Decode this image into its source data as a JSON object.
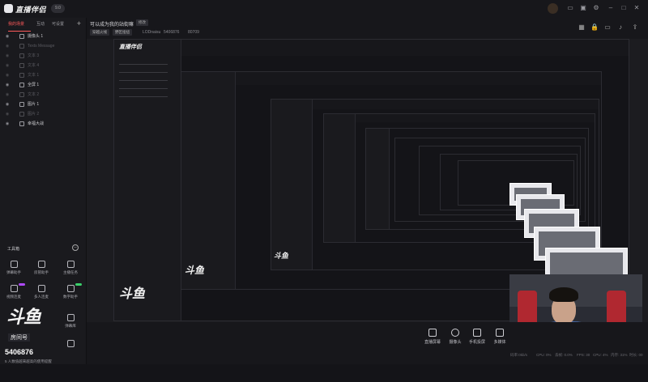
{
  "app": {
    "name": "直播伴侣",
    "version": "9.0"
  },
  "sidebar": {
    "tabs": [
      {
        "label": "我的场景",
        "active": true
      },
      {
        "label": "互动",
        "active": false
      },
      {
        "label": "可设置",
        "active": false
      }
    ],
    "sources": [
      {
        "label": "摄像头 1",
        "icon": "camera-icon",
        "enabled": true
      },
      {
        "label": "Texts Message",
        "icon": "text-icon",
        "enabled": false
      },
      {
        "label": "文本 3",
        "icon": "text-icon",
        "enabled": false
      },
      {
        "label": "文本 4",
        "icon": "text-icon",
        "enabled": false
      },
      {
        "label": "文本 1",
        "icon": "text-icon",
        "enabled": false
      },
      {
        "label": "全屏 1",
        "icon": "fullscreen-icon",
        "enabled": true
      },
      {
        "label": "文本 2",
        "icon": "text-icon",
        "enabled": false
      },
      {
        "label": "图片 1",
        "icon": "image-icon",
        "enabled": true
      },
      {
        "label": "图片 2",
        "icon": "image-icon",
        "enabled": false
      },
      {
        "label": "幸福大战",
        "icon": "game-icon",
        "enabled": true
      }
    ],
    "tools_title": "工具箱",
    "tools": [
      {
        "label": "弹幕助手",
        "icon": "danmaku-icon"
      },
      {
        "label": "房管助手",
        "icon": "admin-icon"
      },
      {
        "label": "主播任务",
        "icon": "task-icon"
      },
      {
        "label": "视频连麦",
        "icon": "video-link-icon"
      },
      {
        "label": "多人连麦",
        "icon": "multi-link-icon"
      },
      {
        "label": "数字助手",
        "icon": "digital-icon"
      },
      {
        "label": "",
        "icon": "record-icon"
      },
      {
        "label": "",
        "icon": "more-icon"
      },
      {
        "label": "弹幕库",
        "icon": "library-icon"
      }
    ],
    "promo": {
      "logo": "斗鱼",
      "room_label": "房间号",
      "room_id": "5406876",
      "line": "5 人数值越来越高的使用提醒"
    }
  },
  "header": {
    "title": "可以成为我的站街嘛",
    "edit_chip": "修改",
    "category": "穿越火线",
    "sub_category": "野区扭扭",
    "username": "LODnaisu",
    "room_id": "5406876",
    "heat": "80709"
  },
  "bottom": {
    "buttons": [
      {
        "label": "直播屏幕",
        "icon": "screen-icon"
      },
      {
        "label": "摄像头",
        "icon": "camera-icon"
      },
      {
        "label": "手机投屏",
        "icon": "phone-cast-icon"
      },
      {
        "label": "多媒体",
        "icon": "media-icon"
      }
    ],
    "stats": [
      "码率:0kb/s",
      "CPU: 0%",
      "丢帧: 0.0%",
      "FPS: 30",
      "CPU: 4%",
      "内存: 31%",
      "时长: 00"
    ]
  },
  "colors": {
    "accent": "#ff5a5a",
    "panel": "#1a1a1e",
    "background": "#141418"
  }
}
